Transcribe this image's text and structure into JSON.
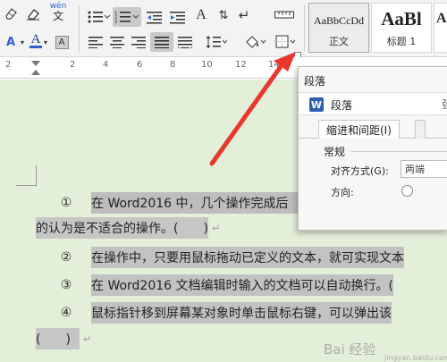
{
  "ribbon": {
    "phonetic_label": "wén",
    "styles": [
      {
        "preview": "AaBbCcDd",
        "label": "正文"
      },
      {
        "preview": "AaBl",
        "label": "标题 1"
      },
      {
        "preview": "Aa",
        "label": ""
      }
    ]
  },
  "ruler": {
    "ticks": [
      "2",
      "2",
      "4",
      "6",
      "8",
      "10",
      "12",
      "14",
      "16",
      "18"
    ]
  },
  "document": {
    "paragraphs": [
      {
        "num": "①",
        "text": "在 Word2016 中，几个操作完成后"
      },
      {
        "num": "",
        "text": "的认为是不适合的操作。(　　)"
      },
      {
        "num": "②",
        "text": "在操作中，只要用鼠标拖动已定义的文本，就可实现文本"
      },
      {
        "num": "③",
        "text": "在 Word2016 文档编辑时输入的文档可以自动换行。("
      },
      {
        "num": "④",
        "text": "鼠标指针移到屏幕某对象时单击鼠标右键，可以弹出该"
      },
      {
        "num": "",
        "text": "(　　)"
      }
    ]
  },
  "dialog": {
    "caption": "段落",
    "title": "段落",
    "title_right": "张",
    "app_icon": "W",
    "tab_label": "缩进和间距(I)",
    "group_label": "常规",
    "align_label": "对齐方式(G):",
    "align_value": "两端",
    "direction_label": "方向:"
  },
  "annotation": {
    "arrow_color": "#e8372c"
  },
  "watermark": {
    "text": "Bai 经验",
    "sub": "jingyan.baidu.com"
  }
}
